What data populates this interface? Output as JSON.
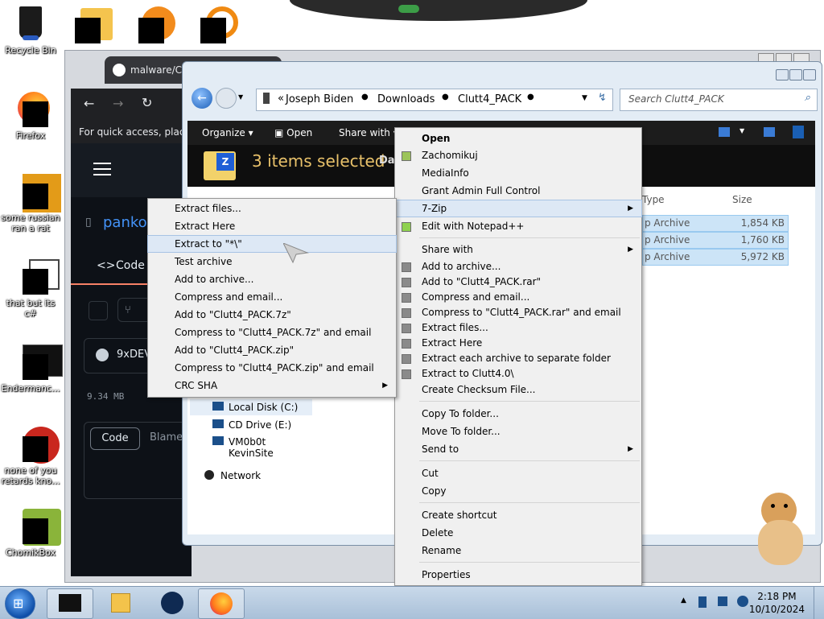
{
  "desktop_icons": [
    {
      "label": "Recycle Bin",
      "icon": "recycle-bin-icon"
    },
    {
      "label": "Firefox",
      "icon": "firefox-icon"
    },
    {
      "label": "some russian ran a rat",
      "icon": "app-icon"
    },
    {
      "label": "that but its c#",
      "icon": "windows-icon"
    },
    {
      "label": "Endermanc...",
      "icon": "window-icon"
    },
    {
      "label": "none of you retards kno...",
      "icon": "app-icon"
    },
    {
      "label": "ChomikBox",
      "icon": "chomikbox-icon"
    }
  ],
  "browser": {
    "tab_title": "malware/Clu",
    "quick_access": "For quick access, place y",
    "repo_owner": "panko",
    "code_tab": "Code",
    "commit_name": "9xDEV",
    "file_size": "9.34 MB",
    "view_code": "Code",
    "view_blame": "Blame"
  },
  "explorer": {
    "breadcrumb_prefix": "«",
    "breadcrumbs": [
      "Joseph Biden",
      "Downloads",
      "Clutt4_PACK"
    ],
    "search_placeholder": "Search Clutt4_PACK",
    "toolbar": {
      "organize": "Organize",
      "open": "Open",
      "share_with": "Share with"
    },
    "selection_text": "3 items selected",
    "selection_sub": "Dat",
    "columns": {
      "type": "Type",
      "size": "Size"
    },
    "files": [
      {
        "type": "p Archive",
        "size": "1,854 KB"
      },
      {
        "type": "p Archive",
        "size": "1,760 KB"
      },
      {
        "type": "p Archive",
        "size": "5,972 KB"
      }
    ],
    "nav": [
      "Local Disk (C:)",
      "CD Drive (E:)",
      "VM0b0t KevinSite",
      "Network"
    ]
  },
  "context_menu": {
    "items": [
      {
        "label": "Open",
        "bold": true
      },
      {
        "label": "Zachomikuj"
      },
      {
        "label": "MediaInfo"
      },
      {
        "label": "Grant Admin Full Control"
      },
      {
        "label": "7-Zip"
      },
      {
        "label": "Edit with Notepad++"
      },
      {
        "label": "Share with"
      },
      {
        "label": "Add to archive..."
      },
      {
        "label": "Add to \"Clutt4_PACK.rar\""
      },
      {
        "label": "Compress and email..."
      },
      {
        "label": "Compress to \"Clutt4_PACK.rar\" and email"
      },
      {
        "label": "Extract files..."
      },
      {
        "label": "Extract Here"
      },
      {
        "label": "Extract each archive to separate folder"
      },
      {
        "label": "Extract to Clutt4.0\\"
      },
      {
        "label": "Create Checksum File..."
      },
      {
        "label": "Copy To folder..."
      },
      {
        "label": "Move To folder..."
      },
      {
        "label": "Send to"
      },
      {
        "label": "Cut"
      },
      {
        "label": "Copy"
      },
      {
        "label": "Create shortcut"
      },
      {
        "label": "Delete"
      },
      {
        "label": "Rename"
      },
      {
        "label": "Properties"
      }
    ]
  },
  "zip_submenu": {
    "items": [
      "Extract files...",
      "Extract Here",
      "Extract to \"*\\\"",
      "Test archive",
      "Add to archive...",
      "Compress and email...",
      "Add to \"Clutt4_PACK.7z\"",
      "Compress to \"Clutt4_PACK.7z\" and email",
      "Add to \"Clutt4_PACK.zip\"",
      "Compress to \"Clutt4_PACK.zip\" and email",
      "CRC SHA"
    ]
  },
  "taskbar": {
    "time": "2:18 PM",
    "date": "10/10/2024"
  }
}
